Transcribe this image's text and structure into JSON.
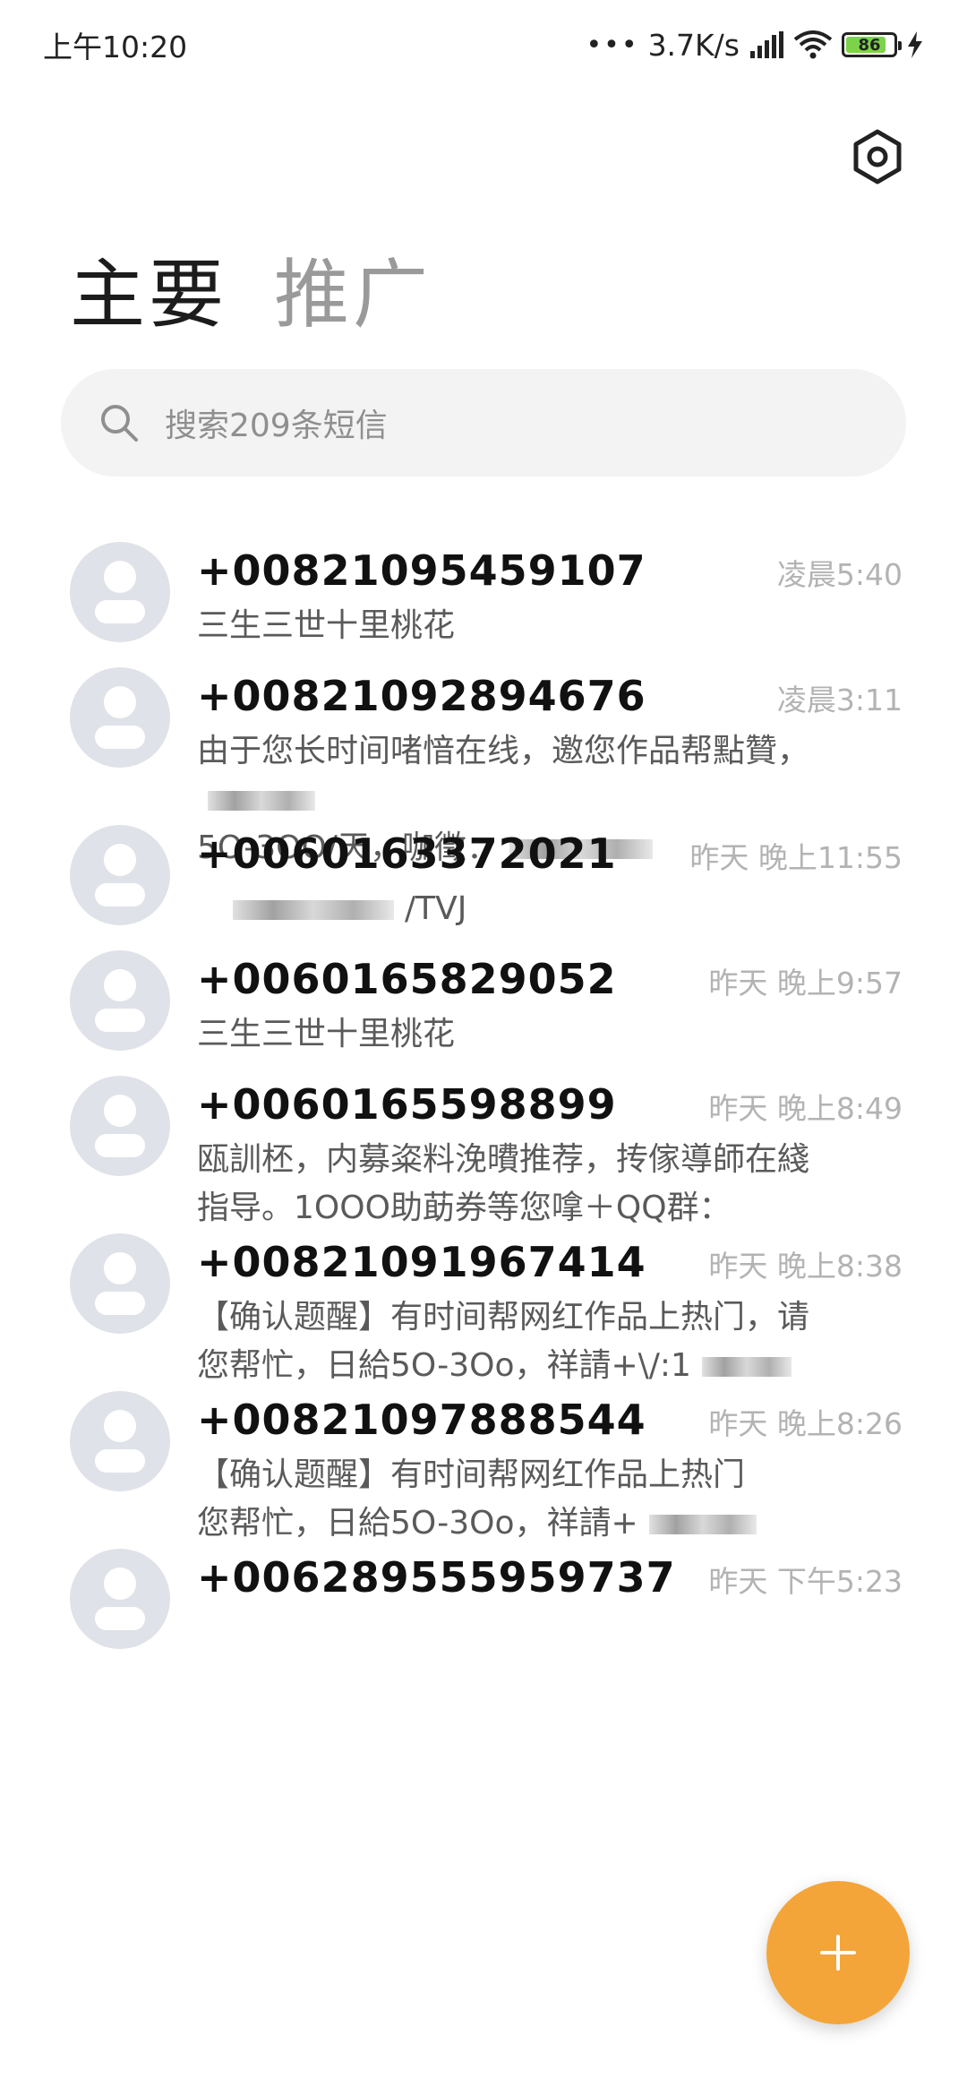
{
  "status_bar": {
    "time": "上午10:20",
    "network_speed": "3.7K/s",
    "battery_level": "86",
    "battery_fraction": 0.86
  },
  "tabs": [
    {
      "label": "主要"
    },
    {
      "label": "推广"
    }
  ],
  "search": {
    "placeholder": "搜索209条短信"
  },
  "messages": [
    {
      "sender": "+00821095459107",
      "time": "凌晨5:40",
      "preview": [
        "三生三世十里桃花"
      ]
    },
    {
      "sender": "+00821092894676",
      "time": "凌晨3:11",
      "preview": [
        "由于您长时间啫愔在线，邀您作品帮點贊，",
        "5O-3OO/天，咖徵："
      ]
    },
    {
      "sender": "+0060163372021",
      "time": "昨天 晚上11:55",
      "preview": [
        "/TVJ"
      ]
    },
    {
      "sender": "+0060165829052",
      "time": "昨天 晚上9:57",
      "preview": [
        "三生三世十里桃花"
      ]
    },
    {
      "sender": "+0060165598899",
      "time": "昨天 晚上8:49",
      "preview": [
        "瓯訓柸，内募粢料浼曊推荐，抟傢導師在綫",
        "指导。1OOO助莇券等您嗱＋QQ群："
      ]
    },
    {
      "sender": "+00821091967414",
      "time": "昨天 晚上8:38",
      "preview": [
        "【确认题醒】有时间帮网红作品上热门，请",
        "您帮忙，日給5O-3Oo，祥請+\\/:1"
      ]
    },
    {
      "sender": "+00821097888544",
      "time": "昨天 晚上8:26",
      "preview": [
        "【确认题醒】有时间帮网红作品上热门",
        "您帮忙，日給5O-3Oo，祥請+"
      ]
    },
    {
      "sender": "+006289555959737",
      "time": "昨天 下午5:23",
      "preview": [
        ""
      ]
    }
  ],
  "colors": {
    "accent_fab": "#f4a53a",
    "avatar_bg": "#dfe2e8",
    "battery_green": "#7cd34a"
  },
  "icons": {
    "settings": "settings-icon",
    "search": "search-icon",
    "compose": "plus-icon"
  }
}
